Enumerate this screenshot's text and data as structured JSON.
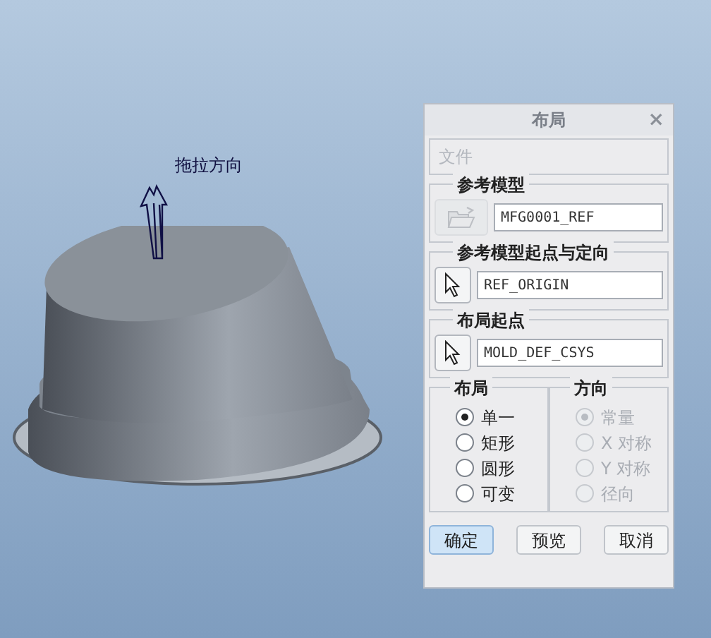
{
  "viewport": {
    "drag_label": "拖拉方向"
  },
  "dialog": {
    "title": "布局",
    "close": "×",
    "menu": [
      {
        "label": "文件",
        "disabled": true
      }
    ],
    "sections": [
      {
        "title": "参考模型",
        "kind": "folder",
        "disabled": true,
        "value": "MFG0001_REF"
      },
      {
        "title": "参考模型起点与定向",
        "kind": "select",
        "disabled": false,
        "value": "REF_ORIGIN"
      },
      {
        "title": "布局起点",
        "kind": "select",
        "disabled": false,
        "value": "MOLD_DEF_CSYS"
      }
    ],
    "option_groups": [
      {
        "title": "布局",
        "disabled": false,
        "options": [
          {
            "label": "单一",
            "selected": true
          },
          {
            "label": "矩形",
            "selected": false
          },
          {
            "label": "圆形",
            "selected": false
          },
          {
            "label": "可变",
            "selected": false
          }
        ]
      },
      {
        "title": "方向",
        "disabled": true,
        "options": [
          {
            "label": "常量",
            "selected": true
          },
          {
            "label": "X 对称",
            "selected": false
          },
          {
            "label": "Y 对称",
            "selected": false
          },
          {
            "label": "径向",
            "selected": false
          }
        ]
      }
    ],
    "buttons": [
      {
        "label": "确定",
        "default": true
      },
      {
        "label": "预览",
        "default": false
      },
      {
        "label": "取消",
        "default": false
      }
    ]
  }
}
